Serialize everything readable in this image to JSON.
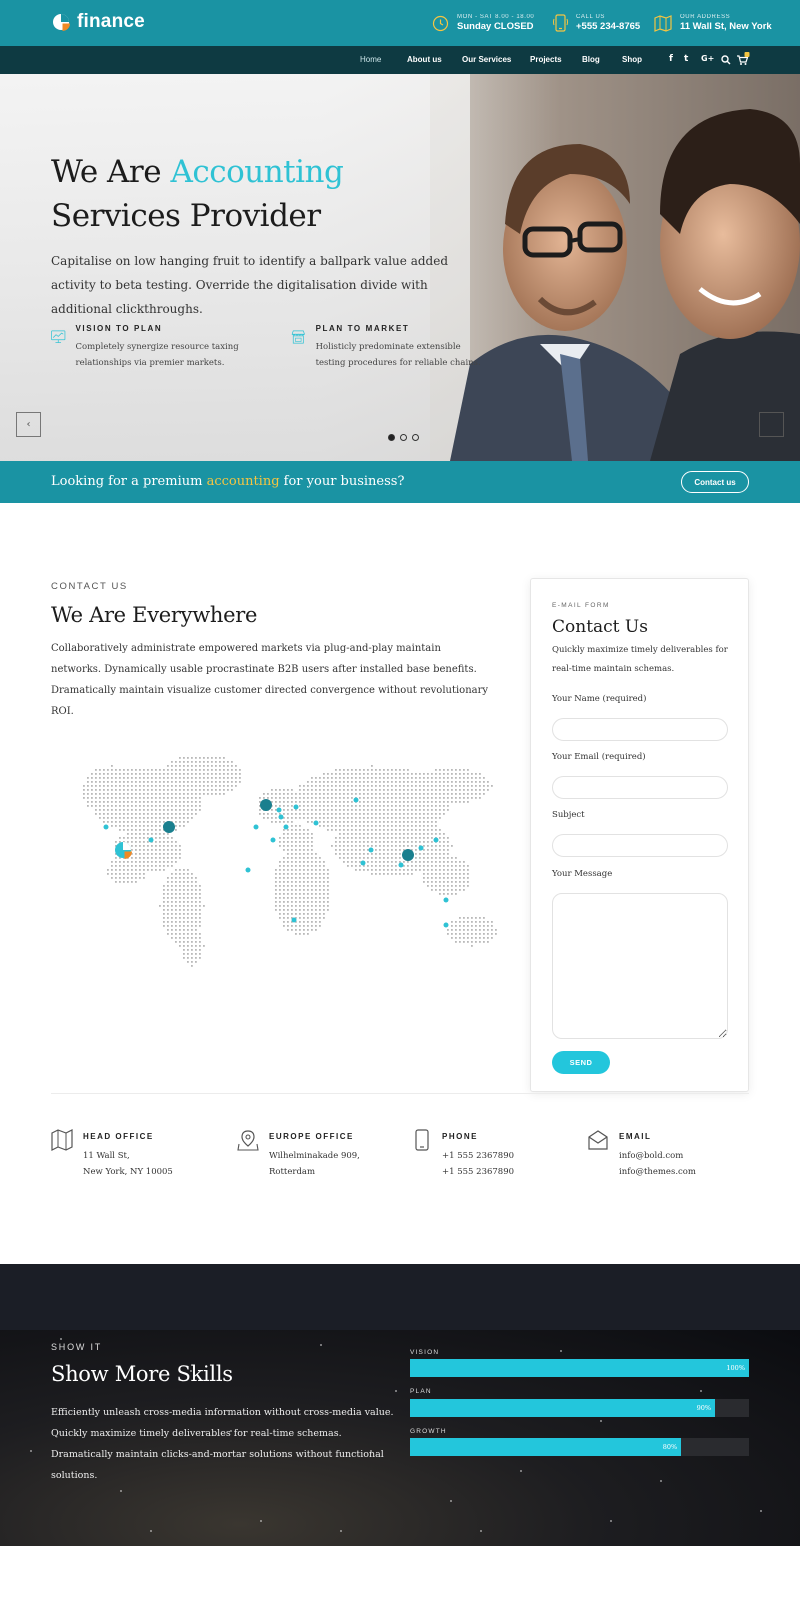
{
  "header": {
    "logo_text": "finance",
    "hours_label": "MON - SAT 8.00 - 18.00",
    "hours_value": "Sunday CLOSED",
    "call_label": "CALL US",
    "call_value": "+555 234-8765",
    "address_label": "OUR ADDRESS",
    "address_value": "11 Wall St, New York"
  },
  "nav": {
    "items": [
      "Home",
      "About us",
      "Our Services",
      "Projects",
      "Blog",
      "Shop"
    ],
    "active": "Home",
    "social": [
      "f",
      "t",
      "G+"
    ],
    "cart_count": ""
  },
  "hero": {
    "title_part1": "We Are ",
    "title_accent": "Accounting",
    "title_line2": "Services Provider",
    "description": "Capitalise on low hanging fruit to identify a ballpark value added activity to beta testing. Override the digitalisation divide with additional clickthroughs.",
    "features": [
      {
        "title": "VISION TO PLAN",
        "desc": "Completely synergize resource taxing relationships via premier markets."
      },
      {
        "title": "PLAN TO MARKET",
        "desc": "Holisticly predominate extensible testing procedures for reliable chains."
      }
    ]
  },
  "cta": {
    "text_before": "Looking for a premium ",
    "text_accent": "accounting",
    "text_after": " for your business?",
    "button": "Contact us"
  },
  "contact": {
    "kicker": "CONTACT US",
    "title": "We Are Everywhere",
    "description": "Collaboratively administrate empowered markets via plug-and-play maintain networks. Dynamically usable procrastinate B2B users after installed base benefits. Dramatically maintain visualize customer directed convergence without revolutionary ROI."
  },
  "form": {
    "kicker": "E-MAIL FORM",
    "title": "Contact Us",
    "description": "Quickly maximize timely deliverables for real-time maintain schemas.",
    "name_label": "Your Name (required)",
    "email_label": "Your Email (required)",
    "subject_label": "Subject",
    "message_label": "Your Message",
    "send": "SEND"
  },
  "offices": [
    {
      "title": "HEAD OFFICE",
      "line1": "11 Wall St,",
      "line2": "New York, NY 10005",
      "icon": "map-icon"
    },
    {
      "title": "EUROPE OFFICE",
      "line1": "Wilhelminakade 909,",
      "line2": "Rotterdam",
      "icon": "map-pin-icon"
    },
    {
      "title": "PHONE",
      "line1": "+1 555 2367890",
      "line2": "+1 555 2367890",
      "icon": "phone-icon"
    },
    {
      "title": "EMAIL",
      "line1": "info@bold.com",
      "line2": "info@themes.com",
      "icon": "envelope-icon"
    }
  ],
  "skills": {
    "kicker": "SHOW IT",
    "title": "Show More Skills",
    "description": "Efficiently unleash cross-media information without cross-media value. Quickly maximize timely deliverables for real-time schemas. Dramatically maintain clicks-and-mortar solutions without functional solutions.",
    "bars": [
      {
        "label": "VISION",
        "value": 100,
        "pct": "100%"
      },
      {
        "label": "PLAN",
        "value": 90,
        "pct": "90%"
      },
      {
        "label": "GROWTH",
        "value": 80,
        "pct": "80%"
      }
    ]
  },
  "colors": {
    "teal": "#1a93a3",
    "navy": "#0e3a42",
    "accent": "#2fc2d4",
    "gold": "#f4c542"
  }
}
